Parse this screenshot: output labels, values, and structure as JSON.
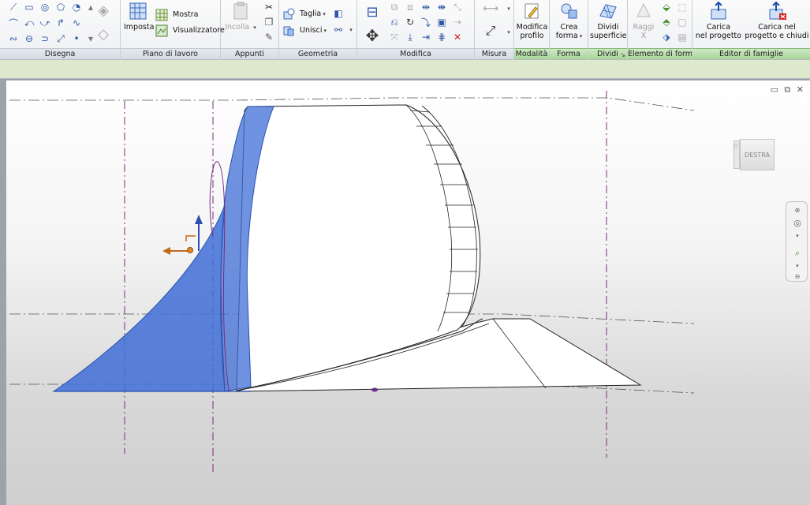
{
  "ribbon": {
    "panels": {
      "disegna": "Disegna",
      "piano_di_lavoro": "Piano di lavoro",
      "appunti": "Appunti",
      "geometria": "Geometria",
      "modifica": "Modifica",
      "misura": "Misura",
      "modalita": "Modalità",
      "forma": "Forma",
      "dividi": "Dividi",
      "elemento_di_forma": "Elemento di forma",
      "editor_di_famiglie": "Editor di famiglie"
    },
    "buttons": {
      "imposta": "Imposta",
      "mostra": "Mostra",
      "visualizzatore": "Visualizzatore",
      "incolla_line1": "Incolla",
      "taglia": "Taglia",
      "unisci": "Unisci",
      "modifica_profilo_line1": "Modifica",
      "modifica_profilo_line2": "profilo",
      "crea_forma_line1": "Crea",
      "crea_forma_line2": "forma",
      "dividi_superficie_line1": "Dividi",
      "dividi_superficie_line2": "superficie",
      "raggi_x": "Raggi X",
      "carica_progetto_line1": "Carica",
      "carica_progetto_line2": "nel progetto",
      "carica_chiudi_line1": "Carica nel",
      "carica_chiudi_line2": "progetto e chiudi"
    }
  },
  "viewport": {
    "viewcube_label": "DESTRA",
    "window_controls": "▭ ⧉ ✕"
  },
  "colors": {
    "selection_blue": "#3f6fd6",
    "ribbon_context_green": "#a7d496",
    "reference_line": "#7a2a7a"
  }
}
